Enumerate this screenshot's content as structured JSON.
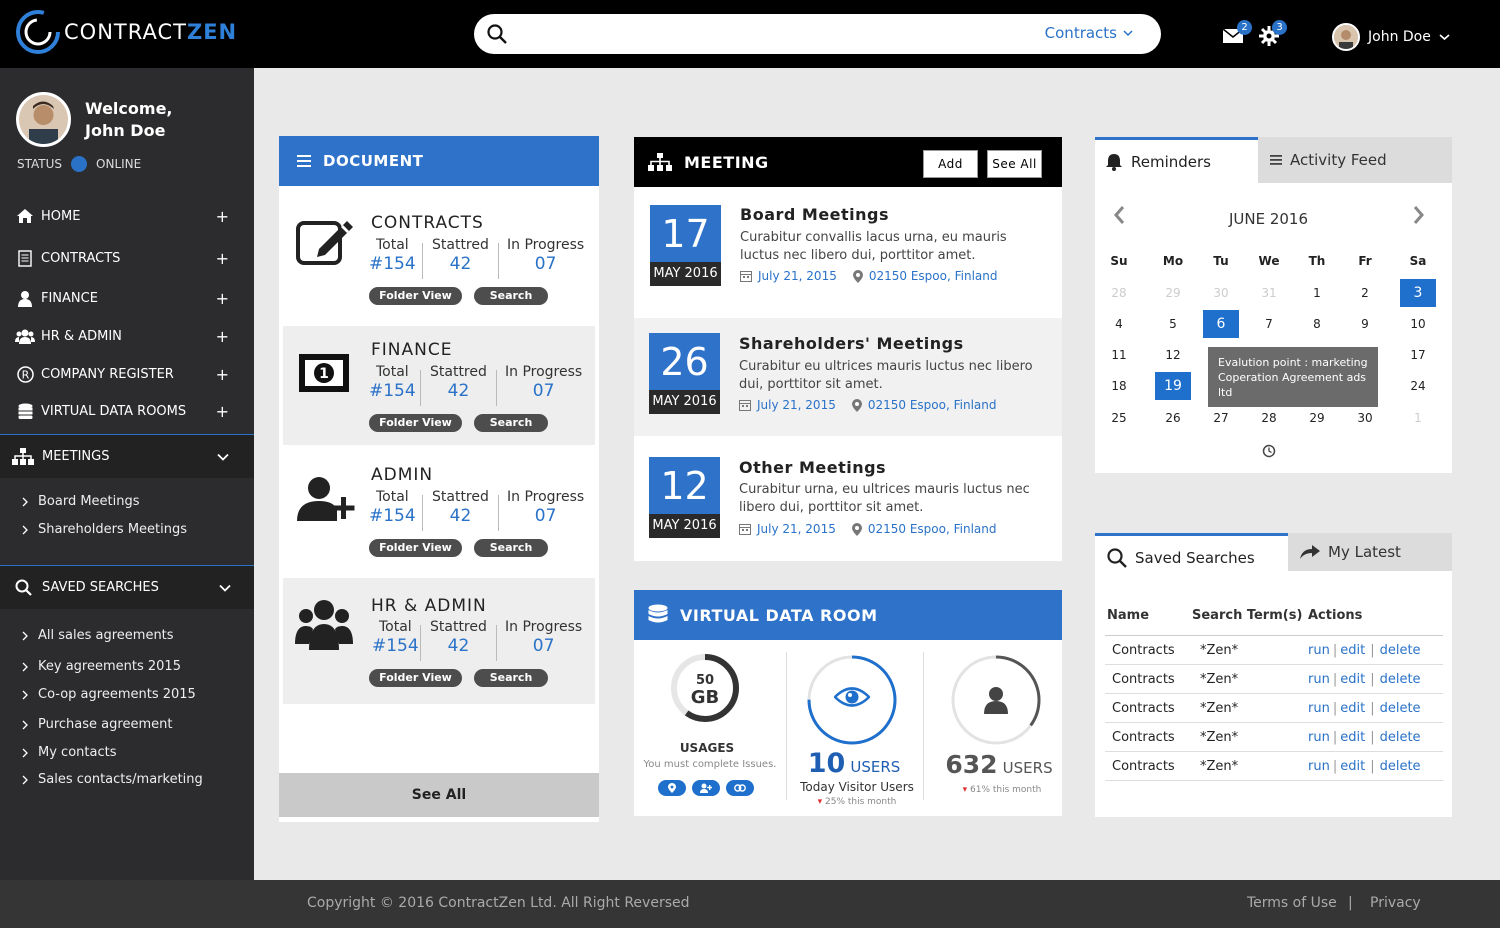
{
  "brand": {
    "name_part1": "CONTRACT",
    "name_part2": "ZEN"
  },
  "search": {
    "placeholder": "",
    "scope": "Contracts"
  },
  "header": {
    "mail_count": "2",
    "settings_count": "3",
    "user_name": "John Doe"
  },
  "sidebar": {
    "welcome_line1": "Welcome,",
    "welcome_line2": "John Doe",
    "status_label": "STATUS",
    "status_value": "ONLINE",
    "nav": [
      {
        "label": "HOME",
        "icon": "home-icon"
      },
      {
        "label": "CONTRACTS",
        "icon": "document-icon"
      },
      {
        "label": "FINANCE",
        "icon": "user-icon"
      },
      {
        "label": "HR  & ADMIN",
        "icon": "users-icon"
      },
      {
        "label": "COMPANY REGISTER",
        "icon": "registered-icon"
      },
      {
        "label": "VIRTUAL DATA ROOMS",
        "icon": "database-icon"
      }
    ],
    "meetings_label": "MEETINGS",
    "meetings_items": [
      "Board Meetings",
      "Shareholders Meetings"
    ],
    "saved_label": "SAVED SEARCHES",
    "saved_items": [
      "All sales agreements",
      "Key agreements 2015",
      "Co-op agreements 2015",
      "Purchase agreement",
      "My contacts",
      "Sales contacts/marketing"
    ]
  },
  "document": {
    "title": "DOCUMENT",
    "items": [
      {
        "title": "CONTRACTS",
        "total_label": "Total",
        "total": "#154",
        "started_label": "Stattred",
        "started": "42",
        "progress_label": "In Progress",
        "progress": "07",
        "folder_btn": "Folder View",
        "search_btn": "Search"
      },
      {
        "title": "FINANCE",
        "total_label": "Total",
        "total": "#154",
        "started_label": "Stattred",
        "started": "42",
        "progress_label": "In Progress",
        "progress": "07",
        "folder_btn": "Folder View",
        "search_btn": "Search"
      },
      {
        "title": "ADMIN",
        "total_label": "Total",
        "total": "#154",
        "started_label": "Stattred",
        "started": "42",
        "progress_label": "In Progress",
        "progress": "07",
        "folder_btn": "Folder View",
        "search_btn": "Search"
      },
      {
        "title": "HR & ADMIN",
        "total_label": "Total",
        "total": "#154",
        "started_label": "Stattred",
        "started": "42",
        "progress_label": "In Progress",
        "progress": "07",
        "folder_btn": "Folder View",
        "search_btn": "Search"
      }
    ],
    "see_all": "See All"
  },
  "meeting": {
    "title": "MEETING",
    "add_btn": "Add",
    "see_all_btn": "See All",
    "items": [
      {
        "day": "17",
        "month": "MAY 2016",
        "title": "Board Meetings",
        "desc": "Curabitur convallis lacus urna, eu  mauris luctus nec libero dui, porttitor amet.",
        "date": "July 21, 2015",
        "location": "02150 Espoo, Finland"
      },
      {
        "day": "26",
        "month": "MAY 2016",
        "title": "Shareholders' Meetings",
        "desc": "Curabitur  eu ultrices mauris luctus nec libero dui, porttitor sit amet.",
        "date": "July 21, 2015",
        "location": "02150 Espoo, Finland"
      },
      {
        "day": "12",
        "month": "MAY 2016",
        "title": "Other Meetings",
        "desc": "Curabitur urna, eu ultrices mauris luctus nec libero dui, porttitor sit amet.",
        "date": "July 21, 2015",
        "location": "02150 Espoo, Finland"
      }
    ]
  },
  "vdr": {
    "title": "VIRTUAL DATA ROOM",
    "usage_value": "50",
    "usage_unit": "GB",
    "usage_label": "USAGES",
    "usage_note": "You must complete Issues.",
    "usage_fraction": 0.6,
    "visitors_value": "10",
    "visitors_unit": "USERS",
    "visitors_label": "Today Visitor Users",
    "visitors_trend": "25% this month",
    "visitors_fraction": 0.75,
    "users_value": "632",
    "users_unit": "USERS",
    "users_trend": "61% this month",
    "users_fraction": 0.35
  },
  "reminders": {
    "tab1": "Reminders",
    "tab2": "Activity Feed",
    "month": "JUNE 2016",
    "weekdays": [
      "Su",
      "Mo",
      "Tu",
      "We",
      "Th",
      "Fr",
      "Sa"
    ],
    "weeks": [
      [
        "28",
        "29",
        "30",
        "31",
        "1",
        "2",
        "3"
      ],
      [
        "4",
        "5",
        "6",
        "7",
        "8",
        "9",
        "10"
      ],
      [
        "11",
        "12",
        "",
        "",
        "",
        "",
        "17"
      ],
      [
        "18",
        "19",
        "",
        "",
        "",
        "",
        "24"
      ],
      [
        "25",
        "26",
        "27",
        "28",
        "29",
        "30",
        "1"
      ]
    ],
    "tooltip": "Evalution point : marketing Coperation Agreement ads ltd"
  },
  "saved": {
    "tab1": "Saved Searches",
    "tab2": "My Latest",
    "col_name": "Name",
    "col_term": "Search Term(s)",
    "col_actions": "Actions",
    "rows": [
      {
        "name": "Contracts",
        "term": "*Zen*",
        "run": "run",
        "edit": "edit",
        "delete": "delete"
      },
      {
        "name": "Contracts",
        "term": "*Zen*",
        "run": "run",
        "edit": "edit",
        "delete": "delete"
      },
      {
        "name": "Contracts",
        "term": "*Zen*",
        "run": "run",
        "edit": "edit",
        "delete": "delete"
      },
      {
        "name": "Contracts",
        "term": "*Zen*",
        "run": "run",
        "edit": "edit",
        "delete": "delete"
      },
      {
        "name": "Contracts",
        "term": "*Zen*",
        "run": "run",
        "edit": "edit",
        "delete": "delete"
      }
    ]
  },
  "footer": {
    "copyright": "Copyright © 2016 ContractZen Ltd. All Right Reversed",
    "terms": "Terms of Use",
    "sep": "|",
    "privacy": "Privacy"
  },
  "colors": {
    "accent": "#2f72c9",
    "topbar": "#000000",
    "sidebar": "#2c2c2e"
  }
}
